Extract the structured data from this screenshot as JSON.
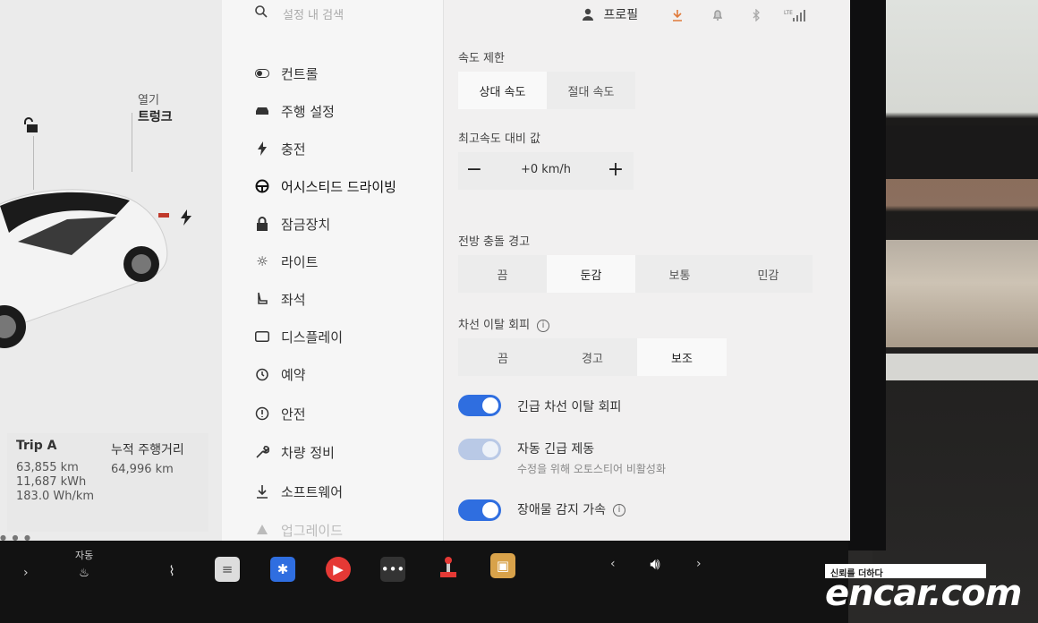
{
  "watermark": {
    "tagline": "신뢰를 더하다",
    "logo": "encar.com"
  },
  "search": {
    "placeholder": "설정 내 검색"
  },
  "status_bar": {
    "profile": "프로필"
  },
  "car_panel": {
    "open_label": "열기",
    "trunk_label": "트렁크",
    "trip": {
      "title": "Trip A",
      "distance": "63,855 km",
      "energy": "11,687 kWh",
      "efficiency": "183.0 Wh/km"
    },
    "odometer": {
      "title": "누적 주행거리",
      "value": "64,996 km"
    }
  },
  "nav": {
    "items": [
      {
        "label": "컨트롤",
        "icon": "toggle-icon"
      },
      {
        "label": "주행 설정",
        "icon": "car-icon"
      },
      {
        "label": "충전",
        "icon": "bolt-icon"
      },
      {
        "label": "어시스티드 드라이빙",
        "icon": "steering-wheel-icon"
      },
      {
        "label": "잠금장치",
        "icon": "lock-icon"
      },
      {
        "label": "라이트",
        "icon": "sun-icon"
      },
      {
        "label": "좌석",
        "icon": "seat-icon"
      },
      {
        "label": "디스플레이",
        "icon": "display-icon"
      },
      {
        "label": "예약",
        "icon": "clock-icon"
      },
      {
        "label": "안전",
        "icon": "shield-icon"
      },
      {
        "label": "차량 정비",
        "icon": "wrench-icon"
      },
      {
        "label": "소프트웨어",
        "icon": "download-icon"
      },
      {
        "label": "업그레이드",
        "icon": "upgrade-icon"
      }
    ]
  },
  "settings": {
    "speed_limit": {
      "label": "속도 제한",
      "options": [
        "상대 속도",
        "절대 속도"
      ],
      "selected": "상대 속도"
    },
    "offset": {
      "label": "최고속도 대비 값",
      "minus": "−",
      "value": "+0 km/h",
      "plus": "+"
    },
    "forward_collision": {
      "label": "전방 충돌 경고",
      "options": [
        "끔",
        "둔감",
        "보통",
        "민감"
      ],
      "selected": "둔감"
    },
    "lane_departure": {
      "label": "차선 이탈 회피",
      "options": [
        "끔",
        "경고",
        "보조"
      ],
      "selected": "보조"
    },
    "toggles": [
      {
        "label": "긴급 차선 이탈 회피",
        "on": true
      },
      {
        "label": "자동 긴급 제동",
        "sub": "수정을 위해 오토스티어 비활성화",
        "on": true,
        "disabled": true
      },
      {
        "label": "장애물 감지 가속",
        "on": true
      }
    ]
  },
  "taskbar": {
    "auto_label": "자동"
  },
  "colors": {
    "accent": "#2f6ee0",
    "warning": "#e07a3a"
  }
}
